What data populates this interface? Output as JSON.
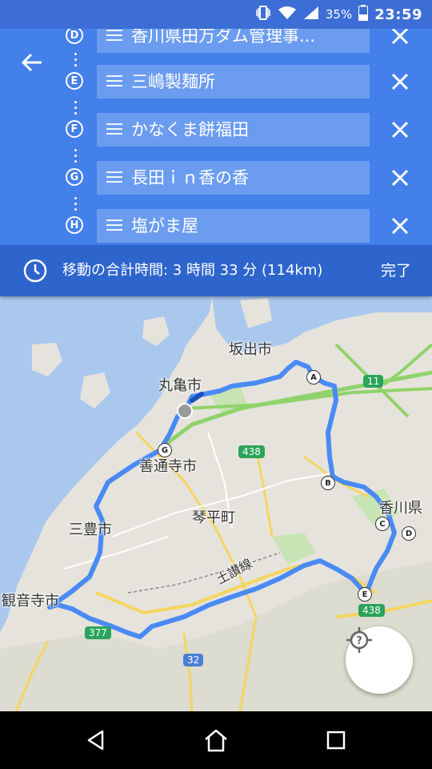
{
  "status_bar": {
    "battery_percent": "35%",
    "time": "23:59",
    "icons": [
      "vibrate-icon",
      "wifi-icon",
      "signal-icon",
      "battery-icon"
    ]
  },
  "header": {
    "back_icon": "arrow-left-icon",
    "stops": [
      {
        "letter": "D",
        "name": "香川県田万ダム管理事..."
      },
      {
        "letter": "E",
        "name": "三嶋製麺所"
      },
      {
        "letter": "F",
        "name": "かなくま餅福田"
      },
      {
        "letter": "G",
        "name": "長田ｉｎ香の香"
      },
      {
        "letter": "H",
        "name": "塩がま屋"
      }
    ]
  },
  "total": {
    "text": "移動の合計時間: 3 時間 33 分  (114km)",
    "done_label": "完了"
  },
  "map": {
    "places": {
      "sakaide": "坂出市",
      "marugame": "丸亀市",
      "zentsuji": "善通寺市",
      "kotohira": "琴平町",
      "mitoyo": "三豊市",
      "kanonji": "観音寺市",
      "kagawa": "香川県",
      "dosan_line": "土讃線"
    },
    "shields": {
      "r11": "11",
      "r438a": "438",
      "r438b": "438",
      "r377": "377",
      "r32": "32"
    },
    "waypoints": {
      "a": "A",
      "b": "B",
      "c": "C",
      "d": "D",
      "e": "E",
      "g": "G"
    },
    "colors": {
      "route": "#4a8af4",
      "highway": "#8fd36a",
      "road": "#f5d560",
      "water": "#aac8ee",
      "land": "#e6e3dc"
    }
  },
  "nav": {
    "back_icon": "nav-back-icon",
    "home_icon": "nav-home-icon",
    "recents_icon": "nav-recents-icon"
  }
}
